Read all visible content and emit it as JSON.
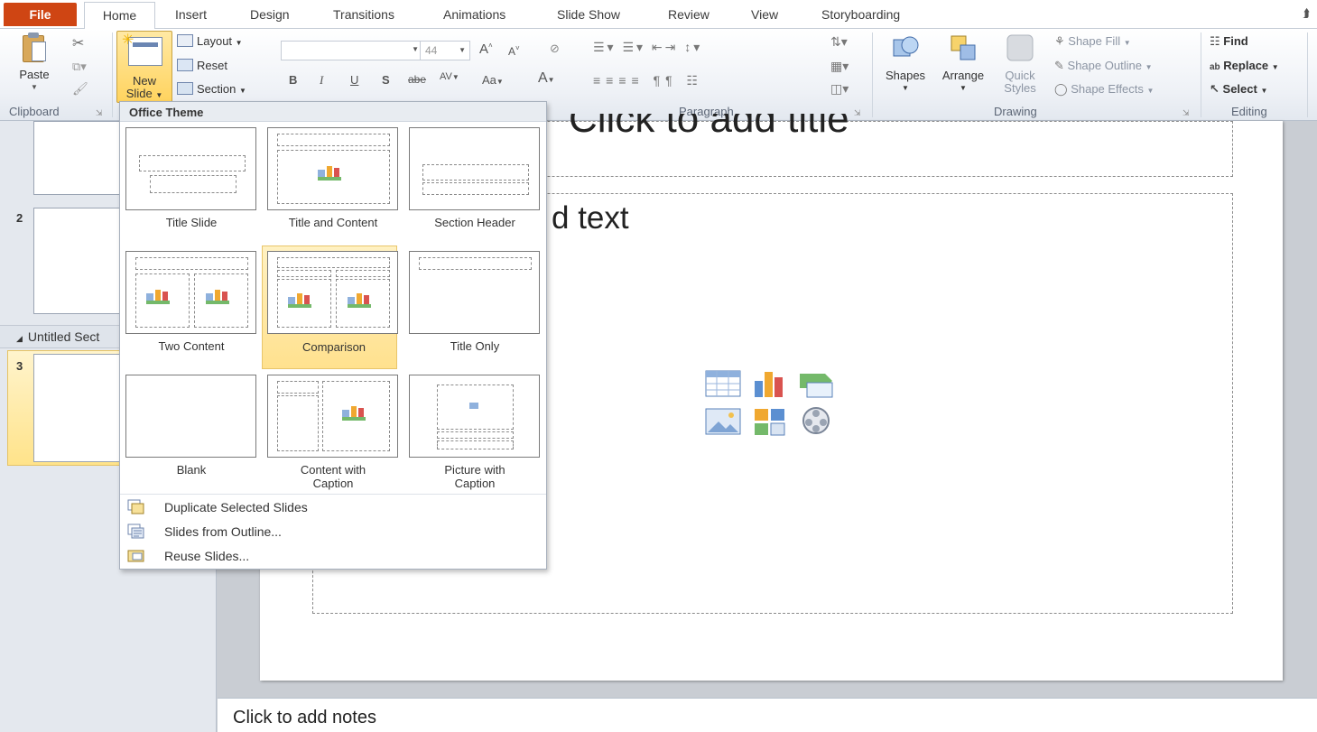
{
  "tabs": {
    "file": "File",
    "home": "Home",
    "insert": "Insert",
    "design": "Design",
    "transitions": "Transitions",
    "animations": "Animations",
    "slideshow": "Slide Show",
    "review": "Review",
    "view": "View",
    "storyboarding": "Storyboarding"
  },
  "ribbon": {
    "clipboard": {
      "paste": "Paste",
      "label": "Clipboard"
    },
    "slides": {
      "new_slide_line1": "New",
      "new_slide_line2": "Slide",
      "layout": "Layout",
      "reset": "Reset",
      "section": "Section"
    },
    "font": {
      "size": "44",
      "bold": "B",
      "italic": "I",
      "underline": "U",
      "shadow": "S",
      "strike": "abe",
      "spacing": "AV",
      "case": "Aa",
      "color": "A",
      "grow": "A",
      "shrink": "A"
    },
    "paragraph": {
      "label": "Paragraph"
    },
    "drawing": {
      "label": "Drawing",
      "shapes": "Shapes",
      "arrange": "Arrange",
      "quick_styles_1": "Quick",
      "quick_styles_2": "Styles",
      "shape_fill": "Shape Fill",
      "shape_outline": "Shape Outline",
      "shape_effects": "Shape Effects"
    },
    "editing": {
      "label": "Editing",
      "find": "Find",
      "replace": "Replace",
      "select": "Select"
    }
  },
  "slides_pane": {
    "slide2_num": "2",
    "section_name": "Untitled Sect",
    "slide3_num": "3"
  },
  "slide": {
    "title_placeholder": "Click to add title",
    "body_placeholder": "d text"
  },
  "notes": {
    "placeholder": "Click to add notes"
  },
  "dropdown": {
    "header": "Office Theme",
    "layouts": [
      {
        "label": "Title Slide"
      },
      {
        "label": "Title and Content"
      },
      {
        "label": "Section Header"
      },
      {
        "label": "Two Content"
      },
      {
        "label": "Comparison"
      },
      {
        "label": "Title Only"
      },
      {
        "label": "Blank"
      },
      {
        "label": "Content with Caption"
      },
      {
        "label": "Picture with Caption"
      }
    ],
    "selected_layout": "Comparison",
    "commands": {
      "duplicate": "Duplicate Selected Slides",
      "outline": "Slides from Outline...",
      "reuse": "Reuse Slides..."
    }
  },
  "colors": {
    "file_tab": "#cf4513",
    "highlight": "#ffe18e",
    "ribbon_bg": "#eef1f6"
  }
}
